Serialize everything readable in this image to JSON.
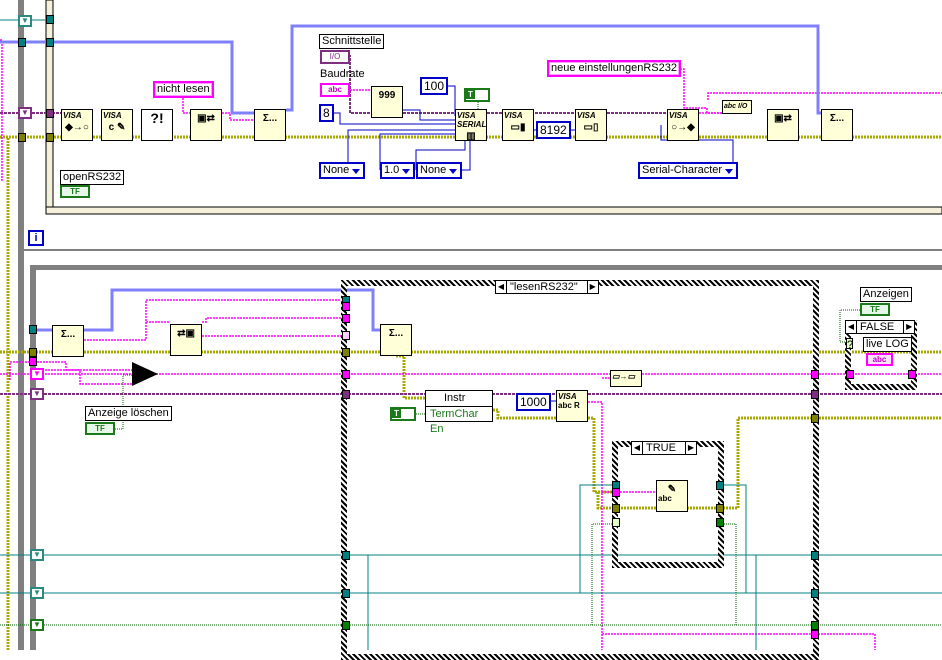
{
  "colors": {
    "error_wire": "#a8a800",
    "string_wire": "#ff00ff",
    "visa_wire": "#7f2f7f",
    "numeric_wire": "#0000c8",
    "teal_wire": "#008080",
    "bool_wire": "#006400",
    "queue_wire": "#8080ff",
    "node_fill": "#ffffd8",
    "loop_border": "#808080"
  },
  "top_frame": {
    "string_constant": "nicht lesen",
    "boolean_label": "openRS232",
    "boolean_value": "TF",
    "iteration_terminal": "i",
    "nodes": [
      {
        "icon": "visa-close-icon",
        "text": "VISA"
      },
      {
        "icon": "visa-clear-icon",
        "text": "VISA"
      },
      {
        "icon": "clear-errors-icon",
        "text": "?!"
      },
      {
        "icon": "bundle-by-name-icon",
        "text": ""
      },
      {
        "icon": "enqueue-element-icon",
        "text": "Σ..."
      },
      {
        "icon": "visa-configure-serial-icon",
        "text": "VISA SERIAL"
      },
      {
        "icon": "visa-set-buffer-icon",
        "text": "VISA"
      },
      {
        "icon": "visa-flush-buffer-icon",
        "text": "VISA"
      },
      {
        "icon": "visa-enable-event-icon",
        "text": "VISA"
      },
      {
        "icon": "bundle-by-name-icon",
        "text": ""
      },
      {
        "icon": "enqueue-element-icon",
        "text": "Σ..."
      }
    ],
    "schnittstelle_label": "Schnittstelle",
    "schnittstelle_value": "I/O",
    "baudrate_label": "Baudrate",
    "baudrate_value": "abc",
    "string_to_number_icon": "999",
    "const_timeout": "100",
    "const_true": "T",
    "const_databits": "8",
    "const_buffer": "8192",
    "parity_ring": "None",
    "stopbits_ring": "1.0",
    "flow_ring": "None",
    "event_ring": "Serial-Character",
    "neue_einstellungen": "neue einstellungenRS232",
    "string_to_io_icon": "abc I/O"
  },
  "bottom_frame": {
    "dequeue_icon": "Σ...",
    "unbundle_icon": "unbundle-by-name-icon",
    "enqueue_icon": "Σ...",
    "select_icon": "select-icon",
    "anzeige_loeschen_label": "Anzeige löschen",
    "anzeige_loeschen_value": "TF",
    "case_selector": "\"lesenRS232\"",
    "property_node": {
      "class": "Instr",
      "property": "TermChar En"
    },
    "const_true": "T",
    "const_timeout": "1000",
    "visa_read": {
      "text": "VISA",
      "sub": "abc",
      "r": "R"
    },
    "concat_icon": "concatenate-icon",
    "inner_case_selector": "TRUE",
    "write_icon": "abc",
    "anzeigen_label": "Anzeigen",
    "anzeigen_value": "TF",
    "log_case_selector": "FALSE",
    "live_log_label": "live LOG",
    "live_log_value": "abc",
    "case_terminal": "?"
  }
}
